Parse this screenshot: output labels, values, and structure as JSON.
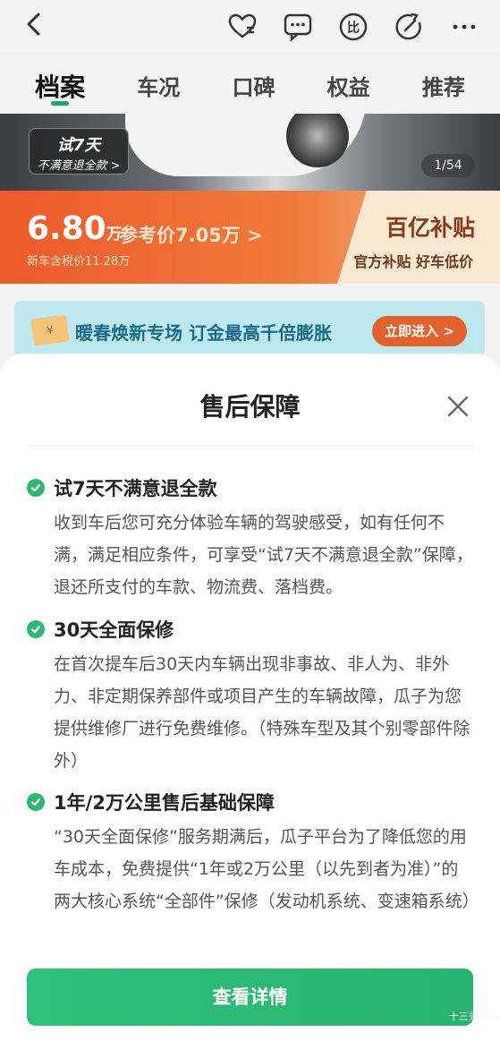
{
  "tabs": [
    {
      "label": "档案"
    },
    {
      "label": "车况"
    },
    {
      "label": "口碑"
    },
    {
      "label": "权益"
    },
    {
      "label": "推荐"
    }
  ],
  "gallery": {
    "badge_line1": "试7天",
    "badge_line2": "不满意退全款 >",
    "counter": "1/54"
  },
  "price": {
    "amount": "6.80",
    "unit": "万",
    "reference": "参考价7.05万 >",
    "new_car": "新车含税价11.28万"
  },
  "subsidy": {
    "title": "百亿补贴",
    "desc": "官方补贴 好车低价"
  },
  "promo": {
    "icon_text": "¥",
    "text": "暖春焕新专场  订金最高千倍膨胀",
    "button": "立即进入 >"
  },
  "sheet": {
    "title": "售后保障",
    "sections": [
      {
        "title": "试7天不满意退全款",
        "body": "收到车后您可充分体验车辆的驾驶感受，如有任何不满，满足相应条件，可享受“试7天不满意退全款”保障，退还所支付的车款、物流费、落档费。"
      },
      {
        "title": "30天全面保修",
        "body": "在首次提车后30天内车辆出现非事故、非人为、非外力、非定期保养部件或项目产生的车辆故障，瓜子为您提供维修厂进行免费维修。（特殊车型及其个别零部件除外）"
      },
      {
        "title": "1年/2万公里售后基础保障",
        "body": "“30天全面保修”服务期满后，瓜子平台为了降低您的用车成本，免费提供“1年或2万公里（以先到者为准）”的两大核心系统“全部件”保修（发动机系统、变速箱系统）"
      }
    ],
    "cta": "查看详情"
  },
  "watermark": "十三先生St",
  "colors": {
    "accent": "#2db871",
    "price_banner": "#ee5a2a",
    "promo_button": "#e3622c"
  },
  "icons": [
    "back-arrow-icon",
    "heart-icon",
    "message-icon",
    "compare-icon",
    "share-icon",
    "more-icon",
    "check-icon",
    "close-icon"
  ]
}
